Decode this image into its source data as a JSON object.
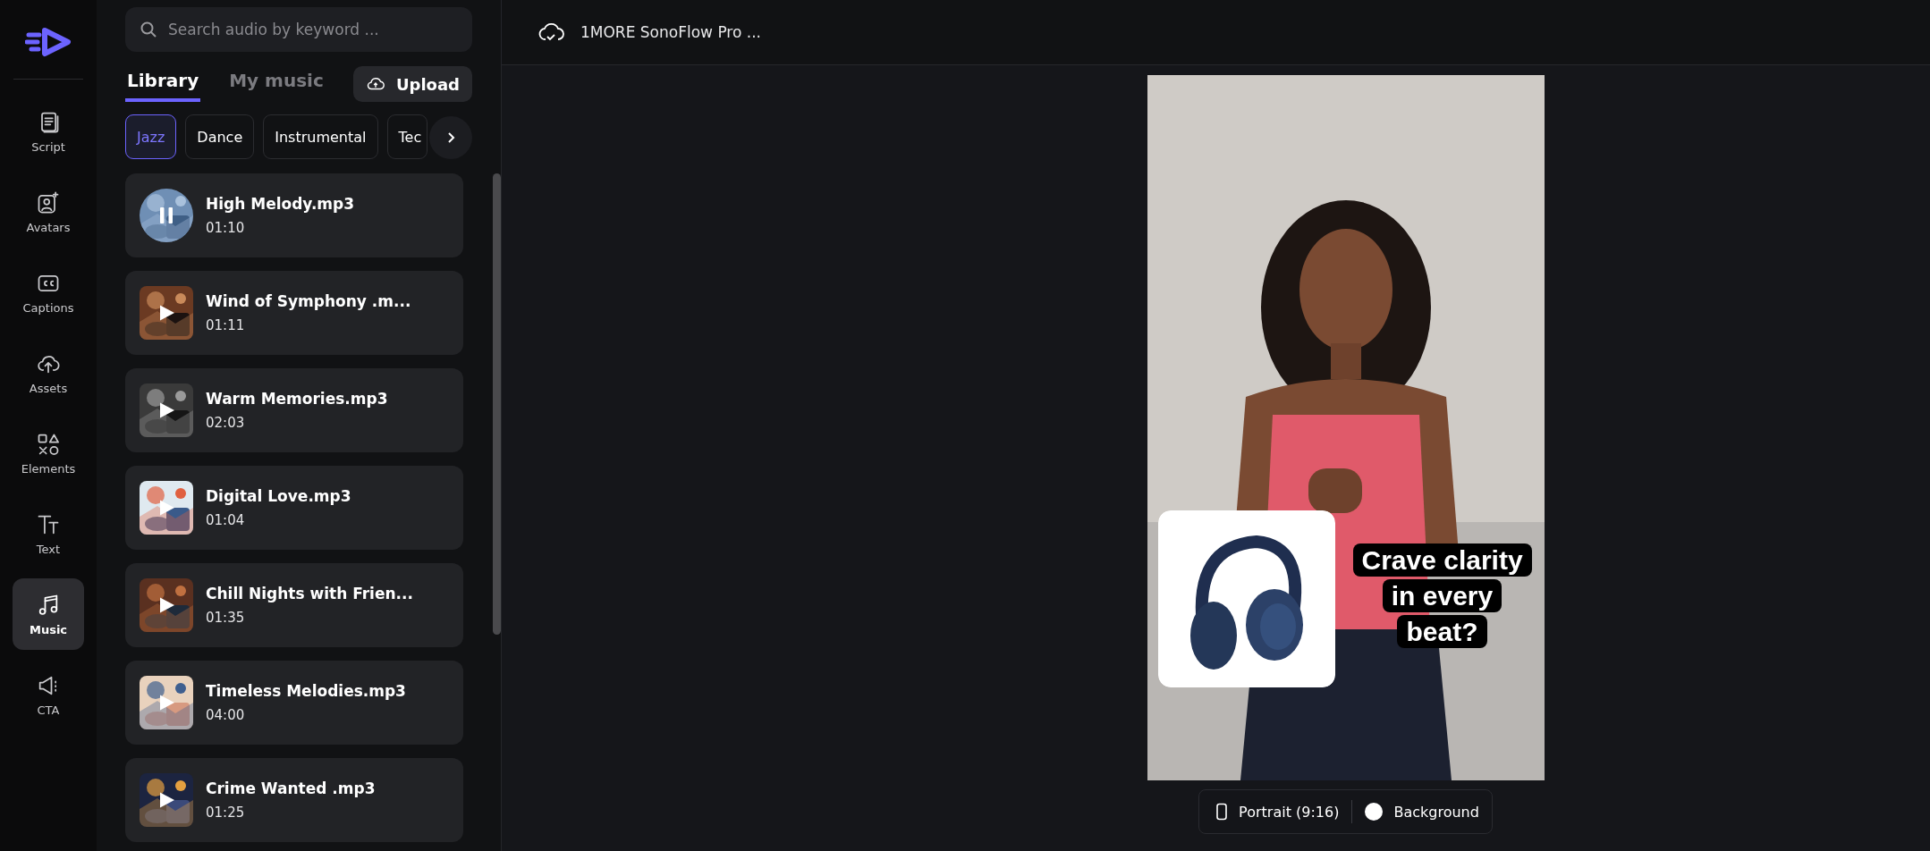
{
  "sidebar": {
    "items": [
      {
        "label": "Script",
        "selected": false
      },
      {
        "label": "Avatars",
        "selected": false
      },
      {
        "label": "Captions",
        "selected": false
      },
      {
        "label": "Assets",
        "selected": false
      },
      {
        "label": "Elements",
        "selected": false
      },
      {
        "label": "Text",
        "selected": false
      },
      {
        "label": "Music",
        "selected": true
      },
      {
        "label": "CTA",
        "selected": false
      }
    ]
  },
  "panel": {
    "search": {
      "placeholder": "Search audio by keyword ..."
    },
    "tabs": [
      {
        "label": "Library",
        "selected": true
      },
      {
        "label": "My music",
        "selected": false
      }
    ],
    "upload_button": "Upload",
    "genres": [
      {
        "label": "Jazz",
        "selected": true
      },
      {
        "label": "Dance",
        "selected": false
      },
      {
        "label": "Instrumental",
        "selected": false
      },
      {
        "label": "Tec",
        "selected": false
      }
    ],
    "tracks": [
      {
        "title": "High Melody.mp3",
        "duration": "01:10",
        "playing": true
      },
      {
        "title": "Wind of Symphony .m...",
        "duration": "01:11",
        "playing": false
      },
      {
        "title": "Warm Memories.mp3",
        "duration": "02:03",
        "playing": false
      },
      {
        "title": "Digital Love.mp3",
        "duration": "01:04",
        "playing": false
      },
      {
        "title": "Chill Nights with Frien...",
        "duration": "01:35",
        "playing": false
      },
      {
        "title": "Timeless Melodies.mp3",
        "duration": "04:00",
        "playing": false
      },
      {
        "title": "Crime Wanted .mp3",
        "duration": "01:25",
        "playing": false
      }
    ]
  },
  "project": {
    "title": "1MORE SonoFlow Pro ..."
  },
  "preview": {
    "caption": "Crave clarity in every beat?",
    "toolbar": {
      "format": "Portrait (9:16)",
      "background": "Background"
    }
  }
}
